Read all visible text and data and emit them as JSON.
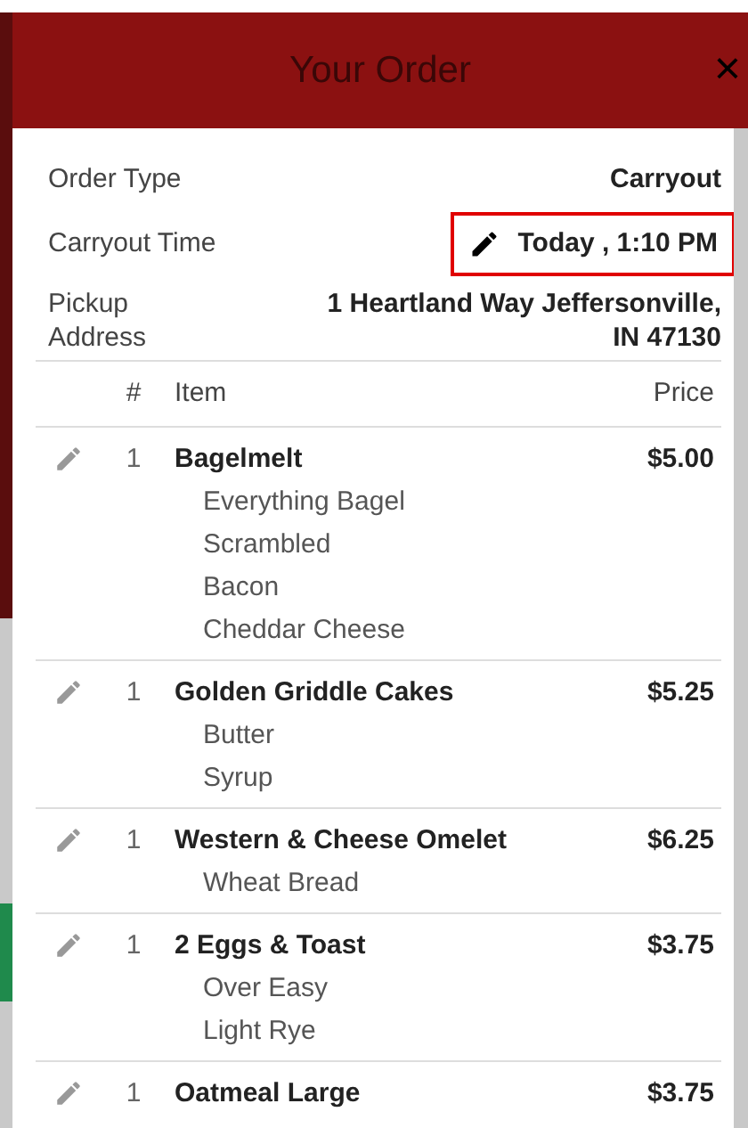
{
  "header": {
    "title": "Your Order",
    "close": "×"
  },
  "details": [
    {
      "label": "Order Type",
      "value": "Carryout",
      "editable": false,
      "highlighted": false
    },
    {
      "label": "Carryout Time",
      "value": "Today , 1:10 PM",
      "editable": true,
      "highlighted": true
    },
    {
      "label": "Pickup Address",
      "value": "1 Heartland Way Jeffersonville, IN 47130",
      "editable": false,
      "highlighted": false
    }
  ],
  "table": {
    "columns": [
      "#",
      "Item",
      "Price"
    ],
    "rows": [
      {
        "qty": "1",
        "item": "Bagelmelt",
        "price": "$5.00",
        "modifiers": [
          "Everything Bagel",
          "Scrambled",
          "Bacon",
          "Cheddar Cheese"
        ]
      },
      {
        "qty": "1",
        "item": "Golden Griddle Cakes",
        "price": "$5.25",
        "modifiers": [
          "Butter",
          "Syrup"
        ]
      },
      {
        "qty": "1",
        "item": "Western & Cheese Omelet",
        "price": "$6.25",
        "modifiers": [
          "Wheat Bread"
        ]
      },
      {
        "qty": "1",
        "item": "2 Eggs & Toast",
        "price": "$3.75",
        "modifiers": [
          "Over Easy",
          "Light Rye"
        ]
      },
      {
        "qty": "1",
        "item": "Oatmeal Large",
        "price": "$3.75",
        "modifiers": []
      }
    ]
  }
}
